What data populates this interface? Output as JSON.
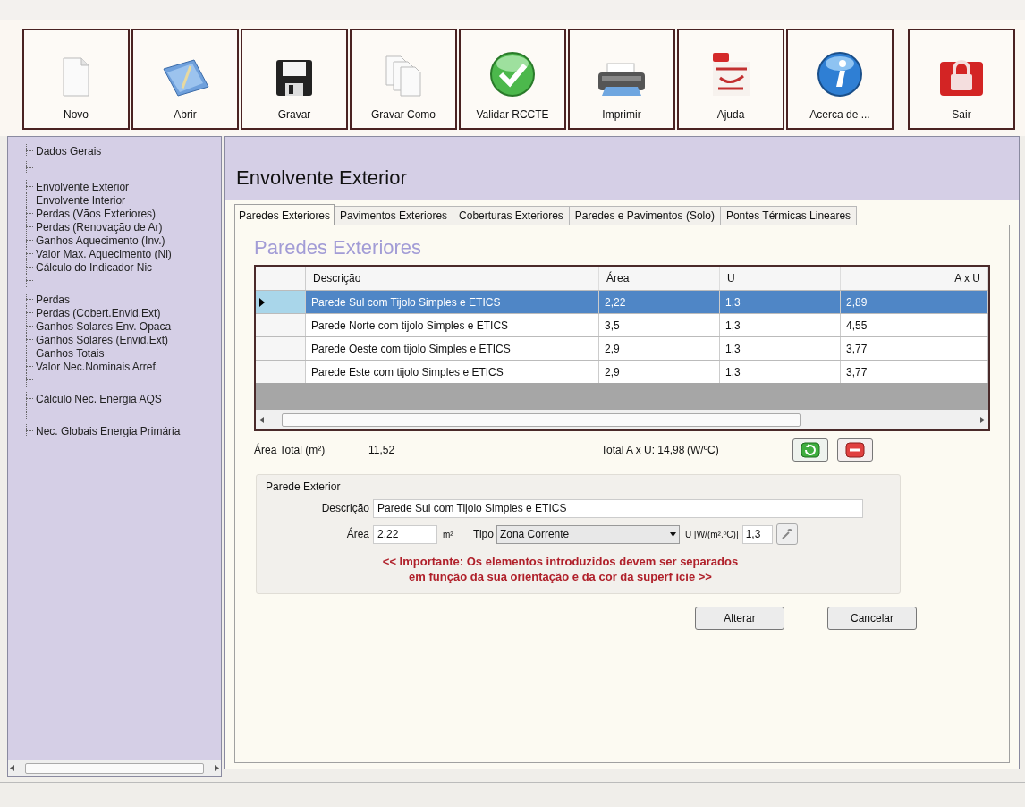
{
  "toolbar": [
    {
      "kind": "new",
      "label": "Novo"
    },
    {
      "kind": "open",
      "label": "Abrir"
    },
    {
      "kind": "save",
      "label": "Gravar"
    },
    {
      "kind": "saveas",
      "label": "Gravar Como"
    },
    {
      "kind": "validate",
      "label": "Validar RCCTE"
    },
    {
      "kind": "print",
      "label": "Imprimir"
    },
    {
      "kind": "manual",
      "label": "Ajuda"
    },
    {
      "kind": "info",
      "label": "Acerca de ..."
    },
    {
      "kind": "exit",
      "label": "Sair"
    }
  ],
  "sidebar": {
    "items": [
      {
        "kind": "entry",
        "label": "Dados Gerais"
      },
      {
        "kind": "separator"
      },
      {
        "kind": "entry",
        "label": "Envolvente Exterior"
      },
      {
        "kind": "entry",
        "label": "Envolvente Interior"
      },
      {
        "kind": "entry",
        "label": "Perdas (Vãos Exteriores)"
      },
      {
        "kind": "entry",
        "label": "Perdas (Renovação de Ar)"
      },
      {
        "kind": "entry",
        "label": "Ganhos Aquecimento (Inv.)"
      },
      {
        "kind": "entry",
        "label": "Valor Max. Aquecimento (Ni)"
      },
      {
        "kind": "entry",
        "label": "Cálculo do Indicador Nic"
      },
      {
        "kind": "separator"
      },
      {
        "kind": "entry",
        "label": "Perdas"
      },
      {
        "kind": "entry",
        "label": "Perdas (Cobert.Envid.Ext)"
      },
      {
        "kind": "entry",
        "label": "Ganhos Solares Env. Opaca"
      },
      {
        "kind": "entry",
        "label": "Ganhos Solares (Envid.Ext)"
      },
      {
        "kind": "entry",
        "label": "Ganhos Totais"
      },
      {
        "kind": "entry",
        "label": "Valor Nec.Nominais Arref."
      },
      {
        "kind": "separator"
      },
      {
        "kind": "entry",
        "label": "Cálculo Nec. Energia AQS"
      },
      {
        "kind": "separator"
      },
      {
        "kind": "entry",
        "label": "Nec. Globais Energia Primária"
      }
    ]
  },
  "page_title": "Envolvente Exterior",
  "tabs": [
    {
      "label": "Paredes Exteriores",
      "selected": true
    },
    {
      "label": "Pavimentos Exteriores",
      "selected": false
    },
    {
      "label": "Coberturas Exteriores",
      "selected": false
    },
    {
      "label": "Paredes e Pavimentos (Solo)",
      "selected": false
    },
    {
      "label": "Pontes Térmicas Lineares",
      "selected": false
    }
  ],
  "section_title": "Paredes Exteriores",
  "table": {
    "columns": [
      "Descrição",
      "Área",
      "U",
      "A x U"
    ],
    "rows": [
      {
        "selected": true,
        "cells": [
          "Parede Sul com Tijolo Simples e ETICS",
          "2,22",
          "1,3",
          "2,89"
        ]
      },
      {
        "selected": false,
        "cells": [
          "Parede Norte com tijolo Simples e ETICS",
          "3,5",
          "1,3",
          "4,55"
        ]
      },
      {
        "selected": false,
        "cells": [
          "Parede Oeste com tijolo Simples e ETICS",
          "2,9",
          "1,3",
          "3,77"
        ]
      },
      {
        "selected": false,
        "cells": [
          "Parede Este com tijolo Simples e ETICS",
          "2,9",
          "1,3",
          "3,77"
        ]
      }
    ]
  },
  "totals": {
    "area_label": "Área Total (m²)",
    "area_value": "11,52",
    "axu_label": "Total A x U: 14,98",
    "axu_unit": "(W/ºC)"
  },
  "form": {
    "legend": "Parede Exterior",
    "description_label": "Descrição",
    "description_value": "Parede Sul com Tijolo Simples e ETICS",
    "area_label": "Área",
    "area_value": "2,22",
    "area_unit": "m²",
    "type_label": "Tipo",
    "type_value": "Zona Corrente",
    "u_label": "U [W/(m².ºC)]",
    "u_value": "1,3",
    "note_lines": [
      "<< Importante: Os elementos introduzidos devem ser separados",
      "em função da sua orientação e da cor da superf icie >>"
    ]
  },
  "buttons": [
    "Alterar",
    "Cancelar"
  ]
}
